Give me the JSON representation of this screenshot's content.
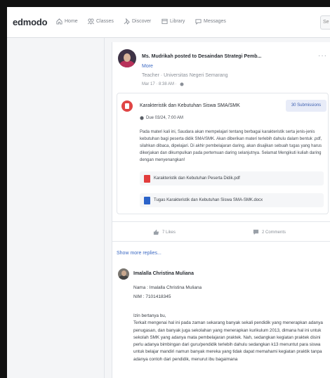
{
  "topnav": {
    "logo": "edmodo",
    "items": [
      {
        "label": "Home",
        "icon": "home-icon"
      },
      {
        "label": "Classes",
        "icon": "classes-icon"
      },
      {
        "label": "Discover",
        "icon": "discover-icon"
      },
      {
        "label": "Library",
        "icon": "library-icon"
      },
      {
        "label": "Messages",
        "icon": "messages-icon"
      }
    ],
    "search_placeholder": "Se"
  },
  "post": {
    "author_line": "Ms. Mudrikah posted to Desaindan Strategi Pemb...",
    "more": "More",
    "role": "Teacher · Universitas Negeri Semarang",
    "timestamp": "Mar 17 · 8:38 AM ·",
    "menu": "···",
    "assignment": {
      "title": "Karakteristik dan Kebutuhan Siswa SMA/SMK",
      "submissions": "30 Submissions",
      "due": "Due 03/24, 7:00 AM",
      "description": "Pada materi kali ini, Saudara akan mempelajari tentang berbagai karakteristik serta jenis-jenis kebutuhan bagi peserta didik SMA/SMK. Akan diberikan materi terlebih dahulu dalam bentuk .pdf, silahkan dibaca, dipelajari. Di akhir pembelajaran daring, akan disajikan sebuah tugas yang harus dikerjakan dan dikumpulkan pada pertemuan daring selanjutnya. Selamat Mengikuti kuliah daring dengan menyenangkan!",
      "files": [
        {
          "name": "Karakteristik dan Kebutuhan Peserta Didik.pdf",
          "type": "pdf"
        },
        {
          "name": "Tugas Karakteristik dan Kebutuhan Siswa SMA-SMK.docx",
          "type": "doc"
        }
      ]
    },
    "likes": "7 Likes",
    "comments": "2 Comments",
    "show_more_replies": "Show more replies..."
  },
  "reply": {
    "author": "Imalalla Christina Muliana",
    "nama_line": "Nama : Imalalla Christina Muliana",
    "nim_line": "NIM : 7101418345",
    "greeting": "Izin bertanya bu,",
    "body": "Terkait mengenai hal ini pada zaman sekarang banyak sekali pendidik yang menerapkan adanya penugasan, dan banyak juga sekolahan yang menerapkan kurikulum 2013, dimana hal ini untuk sekolah SMK yang adanya mata pembelajaran praktek. Nah, sedangkan kegiatan praktek disini perlu adanya bimbingan dari guru/pendidik terlebih dahulu sedangkan k13 menuntut para siswa untuk belajar mandiri namun banyak mereka yang tidak dapat memahami kegiatan praktik tanpa adanya contoh dari pendidik, menurut ibu bagaimana"
  },
  "colors": {
    "brand_blue": "#3d6ac3",
    "assignment_red": "#e04545",
    "pdf_red": "#e23d3d",
    "doc_blue": "#2b63c9"
  }
}
